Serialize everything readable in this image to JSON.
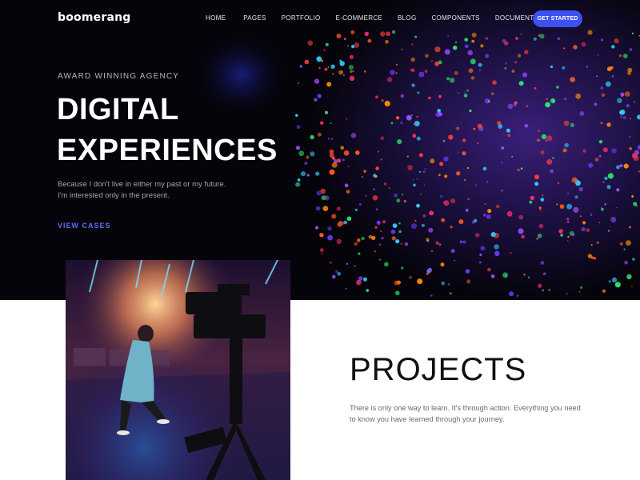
{
  "brand": {
    "logo": "boomerang"
  },
  "nav": {
    "items": [
      "HOME",
      "PAGES",
      "PORTFOLIO",
      "E-COMMERCE",
      "BLOG",
      "COMPONENTS",
      "DOCUMENTATION"
    ],
    "cta": "GET STARTED"
  },
  "hero": {
    "eyebrow": "AWARD WINNING AGENCY",
    "headline_line1": "DIGITAL",
    "headline_line2": "EXPERIENCES",
    "lede_line1": "Because I don't live in either my past or my future.",
    "lede_line2": "I'm interested only in the present.",
    "link": "VIEW CASES"
  },
  "projects": {
    "title": "PROJECTS",
    "text": "There is only one way to learn. It's through action. Everything you need to know you have learned through your journey."
  },
  "colors": {
    "accent": "#3d51f2",
    "link": "#5b6ef6",
    "hero_bg": "#05040a"
  }
}
